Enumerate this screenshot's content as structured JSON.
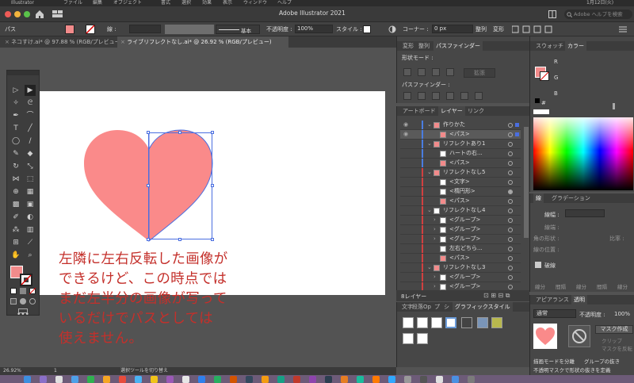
{
  "menubar": {
    "items": [
      "Illustrator",
      "ファイル",
      "編集",
      "オブジェクト",
      "書式",
      "選択",
      "効果",
      "表示",
      "ウィンドウ",
      "ヘルプ"
    ],
    "clock": "1月12日(火)"
  },
  "titlebar": {
    "title": "Adobe Illustrator 2021",
    "help_placeholder": "Adobe ヘルプを検索"
  },
  "control_bar": {
    "selection_label": "パス",
    "stroke_label": "線 :",
    "stroke_style": "基本",
    "opacity_label": "不透明度 :",
    "opacity_value": "100%",
    "style_label": "スタイル :",
    "corner_label": "コーナー :",
    "corner_value": "0 px",
    "align_label": "整列",
    "transform_label": "変形"
  },
  "doc_tabs": [
    {
      "label": "ネコすけ.ai* @ 97.88 % (RGB/プレビュー)",
      "active": false
    },
    {
      "label": "ライブリフレクトなし.ai* @ 26.92 % (RGB/プレビュー)",
      "active": true
    }
  ],
  "annotation": {
    "line1": "左隣に左右反転した画像が",
    "line2": "できるけど、この時点では",
    "line3": "まだ左半分の画像が写って",
    "line4": "いるだけでパスとしては",
    "line5": "使えません。"
  },
  "pathfinder_panel": {
    "tabs": [
      "変形",
      "整列",
      "パスファインダー"
    ],
    "shape_modes_label": "形状モード :",
    "expand_button": "拡張",
    "pathfinders_label": "パスファインダー :"
  },
  "layers_panel": {
    "tabs": [
      "アートボード",
      "レイヤー",
      "リンク"
    ],
    "rows": [
      {
        "name": "作りかた",
        "indent": 0,
        "arrow": "⌄",
        "thumb": "h",
        "bar": "#4a7de0",
        "eye": true,
        "sel": "sq"
      },
      {
        "name": "<パス>",
        "indent": 2,
        "arrow": "",
        "thumb": "h",
        "bar": "#4a7de0",
        "eye": true,
        "sel": "sq",
        "hi": true
      },
      {
        "name": "リフレクトあり1",
        "indent": 0,
        "arrow": "⌄",
        "thumb": "h",
        "bar": "#4a7de0",
        "eye": false,
        "sel": ""
      },
      {
        "name": "ハートの右...",
        "indent": 2,
        "arrow": "",
        "thumb": "w",
        "bar": "#4a7de0",
        "eye": false,
        "sel": ""
      },
      {
        "name": "<パス>",
        "indent": 2,
        "arrow": "",
        "thumb": "h",
        "bar": "#4a7de0",
        "eye": false,
        "sel": ""
      },
      {
        "name": "リフレクトなし5",
        "indent": 0,
        "arrow": "⌄",
        "thumb": "h",
        "bar": "#d04040",
        "eye": false,
        "sel": ""
      },
      {
        "name": "<文字>",
        "indent": 2,
        "arrow": "",
        "thumb": "w",
        "bar": "#d04040",
        "eye": false,
        "sel": ""
      },
      {
        "name": "<楕円形>",
        "indent": 2,
        "arrow": "",
        "thumb": "w",
        "bar": "#d04040",
        "eye": false,
        "sel": "dot"
      },
      {
        "name": "<パス>",
        "indent": 2,
        "arrow": "",
        "thumb": "h",
        "bar": "#d04040",
        "eye": false,
        "sel": ""
      },
      {
        "name": "リフレクトなし4",
        "indent": 0,
        "arrow": "⌄",
        "thumb": "w",
        "bar": "#d04040",
        "eye": false,
        "sel": ""
      },
      {
        "name": "<グループ>",
        "indent": 2,
        "arrow": "›",
        "thumb": "w",
        "bar": "#d04040",
        "eye": false,
        "sel": ""
      },
      {
        "name": "<グループ>",
        "indent": 2,
        "arrow": "›",
        "thumb": "w",
        "bar": "#d04040",
        "eye": false,
        "sel": ""
      },
      {
        "name": "<グループ>",
        "indent": 2,
        "arrow": "›",
        "thumb": "w",
        "bar": "#d04040",
        "eye": false,
        "sel": ""
      },
      {
        "name": "左右どちら...",
        "indent": 2,
        "arrow": "",
        "thumb": "w",
        "bar": "#d04040",
        "eye": false,
        "sel": ""
      },
      {
        "name": "<パス>",
        "indent": 2,
        "arrow": "",
        "thumb": "h",
        "bar": "#d04040",
        "eye": false,
        "sel": ""
      },
      {
        "name": "リフレクトなし3",
        "indent": 0,
        "arrow": "⌄",
        "thumb": "h",
        "bar": "#d04040",
        "eye": false,
        "sel": ""
      },
      {
        "name": "<グループ>",
        "indent": 2,
        "arrow": "›",
        "thumb": "w",
        "bar": "#d04040",
        "eye": false,
        "sel": ""
      },
      {
        "name": "<グループ>",
        "indent": 2,
        "arrow": "›",
        "thumb": "w",
        "bar": "#d04040",
        "eye": false,
        "sel": ""
      },
      {
        "name": "<さんすずか...",
        "indent": 2,
        "arrow": "",
        "thumb": "w",
        "bar": "#d04040",
        "eye": false,
        "sel": ""
      }
    ],
    "layer_count": "8レイヤー"
  },
  "graphic_styles_panel": {
    "tabs": [
      "文字",
      "段落",
      "Op",
      "プ",
      "シ",
      "グラフィックスタイル"
    ]
  },
  "color_panel": {
    "tabs": [
      "スウォッチ",
      "カラー"
    ],
    "r_label": "R",
    "g_label": "G",
    "b_label": "B",
    "hash_label": "#"
  },
  "stroke_panel": {
    "tabs": [
      "線",
      "グラデーション"
    ],
    "weight_label": "線幅 :",
    "cap_label": "線端 :",
    "corner_label": "角の形状 :",
    "ratio_label": "比率 :",
    "align_label": "線の位置 :",
    "dashed_label": "破線",
    "dash_cols": [
      "線分",
      "間隔",
      "線分",
      "間隔",
      "線分"
    ]
  },
  "transparency_panel": {
    "tabs": [
      "アピアランス",
      "透明"
    ],
    "blend_mode": "通常",
    "opacity_label": "不透明度 :",
    "opacity_value": "100%",
    "make_mask_button": "マスク作成",
    "clip_label": "クリップ",
    "invert_label": "マスクを反転",
    "isolate_label": "描画モードを分離",
    "knockout_label": "グループの抜き",
    "opacity_mask_label": "不透明マスクで形状の抜きを定義"
  },
  "status_bar": {
    "zoom": "26.92%",
    "artboard": "1",
    "tool_hint": "選択ツールを切り替え"
  },
  "colors": {
    "heart": "#fa8a8a",
    "selection": "#4a6ee0",
    "annotation": "#c4302b"
  },
  "icons": [
    "apple-icon",
    "home-icon",
    "workspace-icon",
    "search-icon",
    "selection-tool-icon",
    "direct-selection-tool-icon",
    "pen-tool-icon",
    "type-tool-icon",
    "rectangle-tool-icon",
    "eye-icon",
    "color-spectrum-icon",
    "no-mask-icon"
  ]
}
